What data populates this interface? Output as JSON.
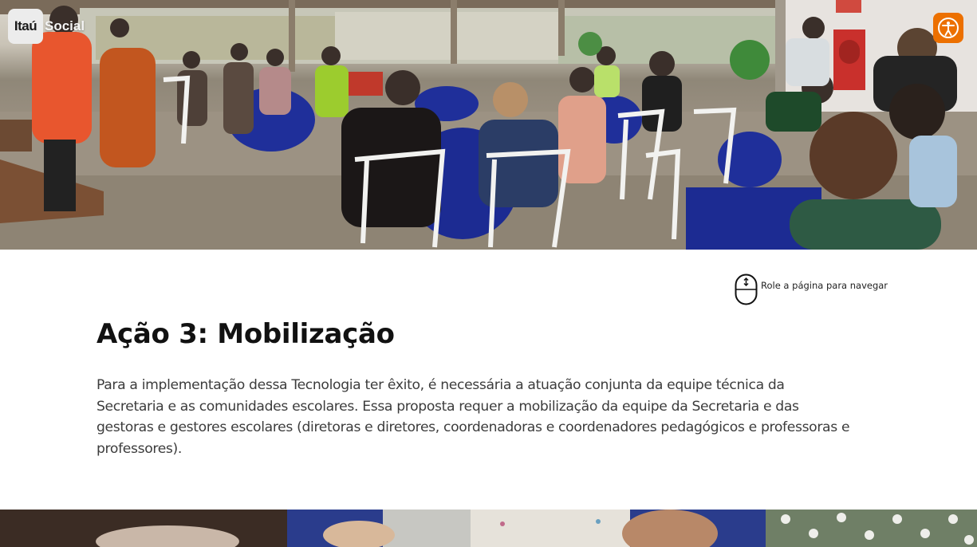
{
  "brand": {
    "mark": "Itaú",
    "word": "Social"
  },
  "accessibility": {
    "icon": "accessibility-icon",
    "color": "#ec7000"
  },
  "hero_photo": {
    "description_icon": "hero-photo"
  },
  "scroll_hint": {
    "icon": "mouse-scroll-icon",
    "label": "Role a página para navegar"
  },
  "section": {
    "title": "Ação 3: Mobilização",
    "body": "Para a implementação dessa Tecnologia ter êxito, é necessária a atuação conjunta da equipe técnica da Secretaria e as comunidades escolares. Essa proposta requer a mobilização da equipe da Secretaria e das gestoras e gestores escolares (diretoras e diretores, coordenadoras e coordenadores pedagógicos e professoras e professores)."
  },
  "colors": {
    "accent": "#ec7000",
    "title": "#111111",
    "body": "#3c3c3c",
    "table_cloth": "#1f2f9a"
  }
}
